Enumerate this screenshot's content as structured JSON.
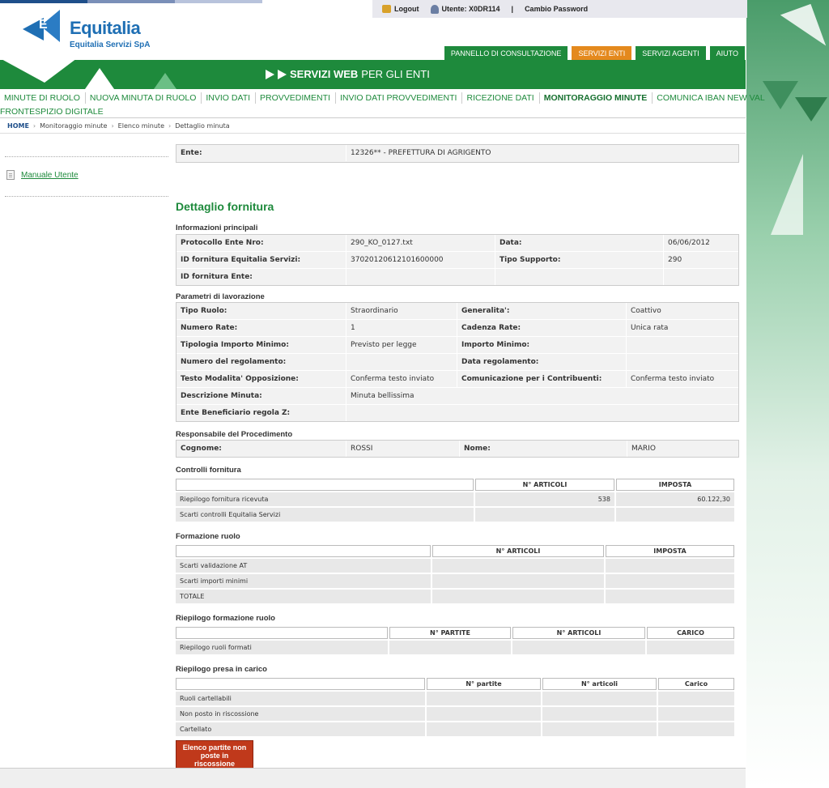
{
  "util": {
    "logout": "Logout",
    "user_label": "Utente: X0DR114",
    "separator": "|",
    "change_password": "Cambio Password"
  },
  "logo": {
    "brand": "Equitalia",
    "subtitle": "Equitalia Servizi SpA",
    "mark_letter": "E"
  },
  "top_tabs": [
    "PANNELLO DI CONSULTAZIONE",
    "SERVIZI ENTI",
    "SERVIZI AGENTI",
    "AIUTO"
  ],
  "banner": {
    "strong": "SERVIZI WEB",
    "rest": "PER GLI ENTI"
  },
  "nav": {
    "items": [
      "MINUTE DI RUOLO",
      "NUOVA MINUTA DI RUOLO",
      "INVIO DATI",
      "PROVVEDIMENTI",
      "INVIO DATI PROVVEDIMENTI",
      "RICEZIONE DATI",
      "MONITORAGGIO MINUTE",
      "COMUNICA IBAN NEW VAL"
    ],
    "second_row": "FRONTESPIZIO DIGITALE"
  },
  "breadcrumb": [
    "HOME",
    "Monitoraggio minute",
    "Elenco minute",
    "Dettaglio minuta"
  ],
  "sidebar": {
    "manual": "Manuale Utente"
  },
  "ente": {
    "label": "Ente:",
    "value": "12326** - PREFETTURA DI AGRIGENTO"
  },
  "title": "Dettaglio fornitura",
  "info": {
    "title": "Informazioni principali",
    "protocollo_label": "Protocollo Ente Nro:",
    "protocollo": "290_KO_0127.txt",
    "data_label": "Data:",
    "data": "06/06/2012",
    "id_eq_label": "ID fornitura Equitalia Servizi:",
    "id_eq": "37020120612101600000",
    "tipo_supp_label": "Tipo Supporto:",
    "tipo_supp": "290",
    "id_ente_label": "ID fornitura Ente:"
  },
  "params": {
    "title": "Parametri di lavorazione",
    "tipo_ruolo_label": "Tipo Ruolo:",
    "tipo_ruolo": "Straordinario",
    "generalita_label": "Generalita':",
    "generalita": "Coattivo",
    "numero_rate_label": "Numero Rate:",
    "numero_rate": "1",
    "cadenza_label": "Cadenza Rate:",
    "cadenza": "Unica rata",
    "tip_imp_label": "Tipologia Importo Minimo:",
    "tip_imp": "Previsto per legge",
    "imp_min_label": "Importo Minimo:",
    "num_reg_label": "Numero del regolamento:",
    "data_reg_label": "Data regolamento:",
    "testo_label": "Testo Modalita' Opposizione:",
    "testo": "Conferma testo inviato",
    "comunic_label": "Comunicazione per i Contribuenti:",
    "comunic": "Conferma testo inviato",
    "descr_label": "Descrizione Minuta:",
    "descr": "Minuta bellissima",
    "benef_label": "Ente Beneficiario regola Z:"
  },
  "resp": {
    "title": "Responsabile del Procedimento",
    "cognome_label": "Cognome:",
    "cognome": "ROSSI",
    "nome_label": "Nome:",
    "nome": "MARIO"
  },
  "controlli": {
    "title": "Controlli fornitura",
    "headers": [
      "N° ARTICOLI",
      "IMPOSTA"
    ],
    "row1": {
      "label": "Riepilogo fornitura ricevuta",
      "articoli": "538",
      "imposta": "60.122,30"
    },
    "row2": {
      "label": "Scarti controlli Equitalia Servizi"
    }
  },
  "formazione": {
    "title": "Formazione ruolo",
    "headers": [
      "N° ARTICOLI",
      "IMPOSTA"
    ],
    "rows": [
      "Scarti validazione AT",
      "Scarti importi minimi",
      "TOTALE"
    ]
  },
  "riepilogo": {
    "title": "Riepilogo formazione ruolo",
    "headers": [
      "N° PARTITE",
      "N° ARTICOLI",
      "CARICO"
    ],
    "row": "Riepilogo ruoli formati"
  },
  "presa": {
    "title": "Riepilogo presa in carico",
    "headers": [
      "N° partite",
      "N° articoli",
      "Carico"
    ],
    "rows": [
      "Ruoli cartellabili",
      "Non posto in riscossione",
      "Cartellato"
    ]
  },
  "button": {
    "line1": "Elenco partite non",
    "line2": "poste in riscossione"
  },
  "colors": {
    "green": "#1e8a3c",
    "orange": "#e4891d",
    "blue": "#1f6fb4",
    "button_red": "#c0391b"
  }
}
